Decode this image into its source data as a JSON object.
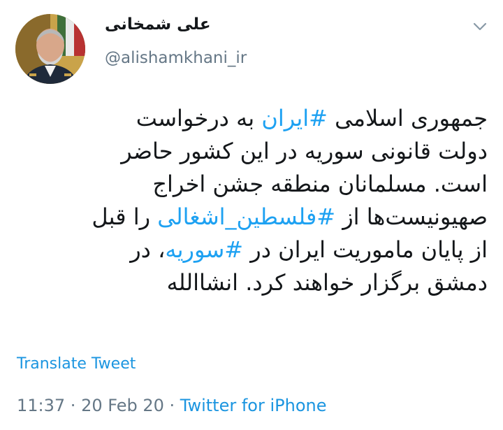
{
  "author": {
    "display_name": "علی شمخانی",
    "handle": "@alishamkhani_ir"
  },
  "icons": {
    "avatar": "profile-photo",
    "menu": "chevron-down-icon"
  },
  "tweet": {
    "line1": {
      "t1": "جمهوری اسلامی ",
      "tag": "#ایران",
      "t2": " به درخواست"
    },
    "line2": "دولت قانونی سوریه در این کشور حاضر",
    "line3": "است. مسلمانان منطقه جشن اخراج",
    "line4": {
      "t1": "صهیونیست‌ها از ",
      "tag": "#فلسطین_اشغالی",
      "t2": " را قبل"
    },
    "line5": {
      "t1": "از پایان ماموریت ایران در ",
      "tag": "#سوریه",
      "t2": "، در"
    },
    "line6": "دمشق برگزار خواهند کرد. انشاالله"
  },
  "translate_label": "Translate Tweet",
  "meta": {
    "time": "11:37",
    "sep1": " · ",
    "date": "20 Feb 20",
    "sep2": " · ",
    "source": "Twitter for iPhone"
  },
  "colors": {
    "link": "#1b95e0",
    "hashtag": "#1da1f2",
    "muted": "#657786",
    "text": "#14171a"
  }
}
